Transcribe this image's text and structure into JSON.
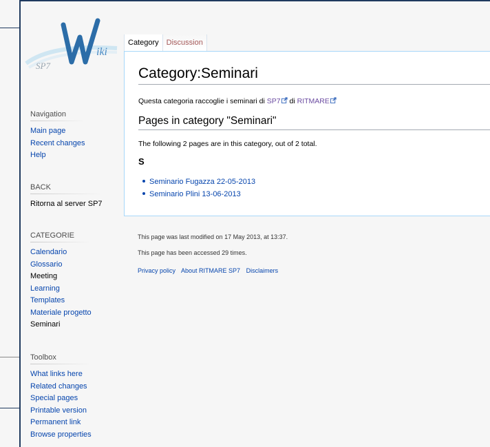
{
  "logo": {
    "text": "SP7",
    "letter": "W",
    "suffix": "iki"
  },
  "sidebar": {
    "navigation": {
      "heading": "Navigation",
      "items": [
        "Main page",
        "Recent changes",
        "Help"
      ]
    },
    "back": {
      "heading": "BACK",
      "items": [
        "Ritorna al server SP7"
      ]
    },
    "categorie": {
      "heading": "CATEGORIE",
      "items": [
        "Calendario",
        "Glossario",
        "Meeting",
        "Learning",
        "Templates",
        "Materiale progetto",
        "Seminari"
      ]
    },
    "toolbox": {
      "heading": "Toolbox",
      "items": [
        "What links here",
        "Related changes",
        "Special pages",
        "Printable version",
        "Permanent link",
        "Browse properties"
      ]
    }
  },
  "tabs": {
    "category": "Category",
    "discussion": "Discussion"
  },
  "content": {
    "title": "Category:Seminari",
    "desc_prefix": "Questa categoria raccoglie i seminari di ",
    "desc_link1": "SP7",
    "desc_middle": " di ",
    "desc_link2": "RITMARE",
    "section_heading": "Pages in category \"Seminari\"",
    "count_text": "The following 2 pages are in this category, out of 2 total.",
    "letter": "S",
    "pages": [
      "Seminario Fugazza 22-05-2013",
      "Seminario Plini 13-06-2013"
    ]
  },
  "footer": {
    "last_modified": "This page was last modified on 17 May 2013, at 13:37.",
    "accessed": "This page has been accessed 29 times.",
    "links": [
      "Privacy policy",
      "About RITMARE SP7",
      "Disclaimers"
    ]
  },
  "colors": {
    "link": "#0645ad",
    "visited": "#6b4ba1",
    "frame": "#1f3a5f",
    "border": "#a7d7f9"
  }
}
